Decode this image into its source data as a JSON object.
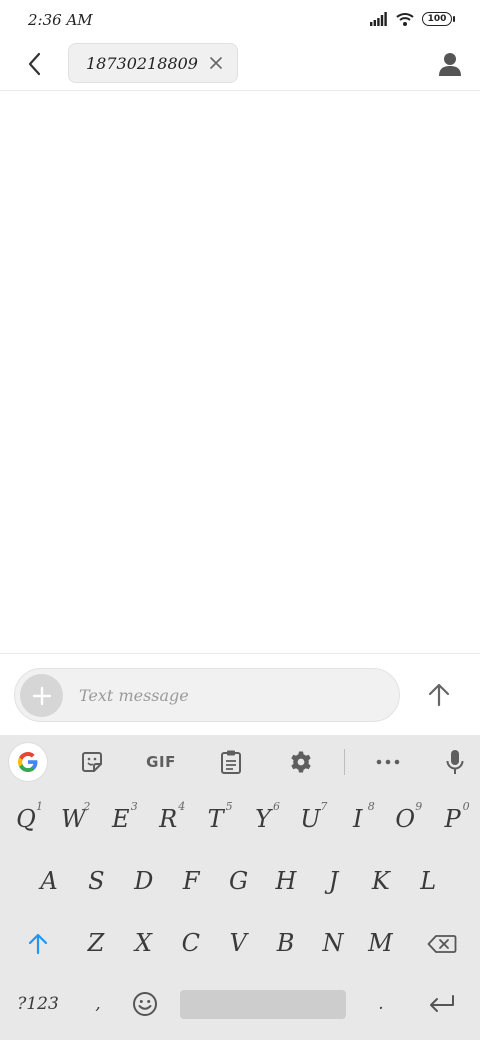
{
  "status_bar": {
    "time": "2:36 AM",
    "battery": "100"
  },
  "header": {
    "recipient": "18730218809"
  },
  "compose": {
    "placeholder": "Text message"
  },
  "keyboard": {
    "toolbar": {
      "gif_label": "GIF"
    },
    "row1": [
      {
        "label": "Q",
        "hint": "1"
      },
      {
        "label": "W",
        "hint": "2"
      },
      {
        "label": "E",
        "hint": "3"
      },
      {
        "label": "R",
        "hint": "4"
      },
      {
        "label": "T",
        "hint": "5"
      },
      {
        "label": "Y",
        "hint": "6"
      },
      {
        "label": "U",
        "hint": "7"
      },
      {
        "label": "I",
        "hint": "8"
      },
      {
        "label": "O",
        "hint": "9"
      },
      {
        "label": "P",
        "hint": "0"
      }
    ],
    "row2": [
      "A",
      "S",
      "D",
      "F",
      "G",
      "H",
      "J",
      "K",
      "L"
    ],
    "row3": [
      "Z",
      "X",
      "C",
      "V",
      "B",
      "N",
      "M"
    ],
    "row4": {
      "symbols": "?123",
      "comma": ",",
      "period": "."
    }
  }
}
